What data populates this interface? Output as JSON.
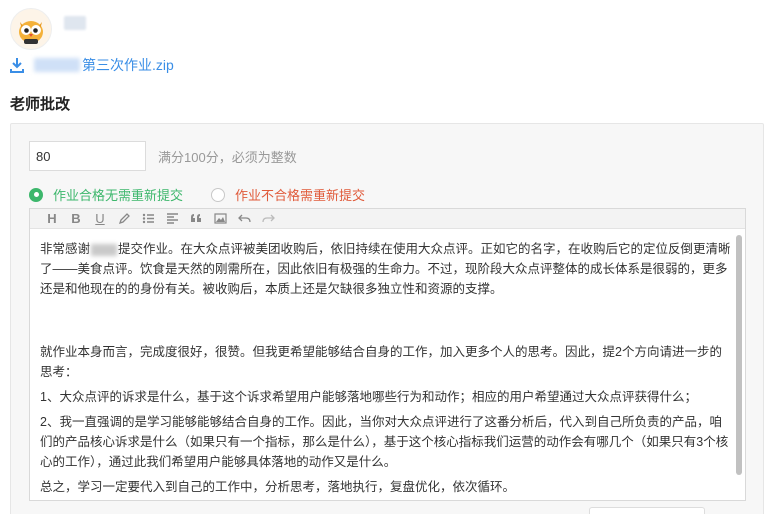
{
  "header": {
    "avatar_icon": "cartoon-owl-avatar",
    "username": ""
  },
  "attachment": {
    "icon": "download-icon",
    "filename": "第三次作业.zip"
  },
  "section": {
    "title": "老师批改"
  },
  "score": {
    "value": "80",
    "hint": "满分100分，必须为整数"
  },
  "result_options": [
    {
      "label": "作业合格无需重新提交",
      "selected": true,
      "color": "#3db76c"
    },
    {
      "label": "作业不合格需重新提交",
      "selected": false,
      "color": "#e05a3a"
    }
  ],
  "toolbar": {
    "tools": [
      "heading-icon",
      "bold-icon",
      "underline-icon",
      "pen-icon",
      "list-icon",
      "align-icon",
      "quote-icon",
      "image-icon",
      "undo-icon",
      "redo-icon"
    ],
    "labels": {
      "heading": "H",
      "bold": "B",
      "underline": "U"
    }
  },
  "comment": {
    "p1_before": "非常感谢",
    "p1_after": "提交作业。在大众点评被美团收购后，依旧持续在使用大众点评。正如它的名字，在收购后它的定位反倒更清晰了——美食点评。饮食是天然的刚需所在，因此依旧有极强的生命力。不过，现阶段大众点评整体的成长体系是很弱的，更多还是和他现在的的身份有关。被收购后，本质上还是欠缺很多独立性和资源的支撑。",
    "p2": "就作业本身而言，完成度很好，很赞。但我更希望能够结合自身的工作，加入更多个人的思考。因此，提2个方向请进一步的思考：",
    "p3": "1、大众点评的诉求是什么，基于这个诉求希望用户能够落地哪些行为和动作；相应的用户希望通过大众点评获得什么；",
    "p4": "2、我一直强调的是学习能够能够结合自身的工作。因此，当你对大众点评进行了这番分析后，代入到自己所负责的产品，咱们的产品核心诉求是什么（如果只有一个指标，那么是什么），基于这个核心指标我们运营的动作会有哪几个（如果只有3个核心的工作），通过此我们希望用户能够具体落地的动作又是什么。",
    "p5": "总之，学习一定要代入到自己的工作中，分析思考，落地执行，复盘优化，依次循环。"
  },
  "colors": {
    "accent_green": "#3db76c",
    "accent_red": "#e05a3a",
    "link_blue": "#3a8ee6"
  }
}
